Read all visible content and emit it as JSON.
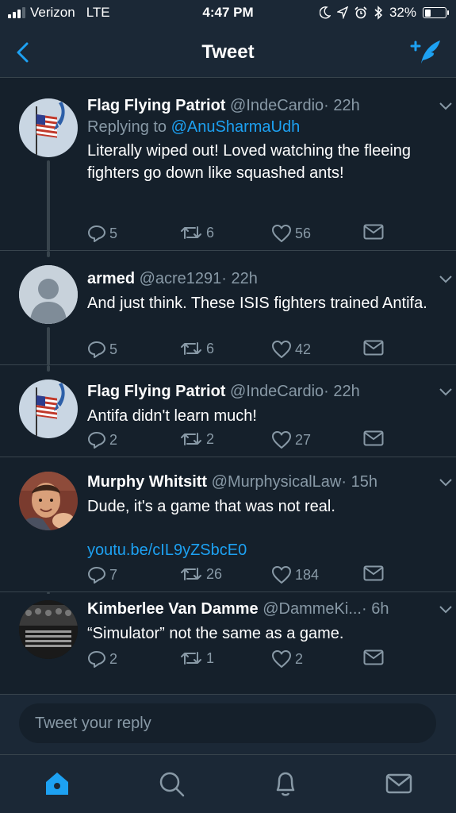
{
  "status_bar": {
    "carrier": "Verizon",
    "network": "LTE",
    "time": "4:47 PM",
    "battery": "32%",
    "battery_level": 0.32,
    "signal_bars": 3
  },
  "nav": {
    "title": "Tweet",
    "back_icon": "chevron-left-icon",
    "compose_icon": "compose-tweet-icon"
  },
  "colors": {
    "background": "#15202b",
    "accent": "#1da1f2",
    "secondary_text": "#8899a6",
    "divider": "#38444d"
  },
  "tweets": [
    {
      "name": "Flag Flying Patriot",
      "handle": "@IndeCardio",
      "dot": "·",
      "time": "22h",
      "replying_label": "Replying to ",
      "replying_to": "@AnuSharmaUdh",
      "text": "Literally wiped out! Loved watching the fleeing fighters go down like squashed ants!",
      "replies": "5",
      "retweets": "6",
      "likes": "56"
    },
    {
      "name": "armed",
      "handle": "@acre1291",
      "dot": "·",
      "time": "22h",
      "text": "And just think. These ISIS fighters trained Antifa.",
      "replies": "5",
      "retweets": "6",
      "likes": "42"
    },
    {
      "name": "Flag Flying Patriot",
      "handle": "@IndeCardio",
      "dot": "·",
      "time": "22h",
      "text": "Antifa didn't learn much!",
      "replies": "2",
      "retweets": "2",
      "likes": "27"
    },
    {
      "name": "Murphy Whitsitt",
      "handle": "@MurphysicalLaw",
      "dot": "·",
      "time": "15h",
      "text": "Dude, it's a game that was not real.",
      "link": "youtu.be/cIL9yZSbcE0",
      "replies": "7",
      "retweets": "26",
      "likes": "184"
    },
    {
      "name": "Kimberlee Van Damme",
      "handle": "@DammeKi...",
      "dot": "·",
      "time": "6h",
      "text": "“Simulator” not the same as a game.",
      "replies": "2",
      "retweets": "1",
      "likes": "2"
    }
  ],
  "reply_bar": {
    "placeholder": "Tweet your reply"
  },
  "tab_bar": {
    "items": [
      "home-icon",
      "search-icon",
      "notifications-icon",
      "messages-icon"
    ],
    "active": "home-icon"
  }
}
